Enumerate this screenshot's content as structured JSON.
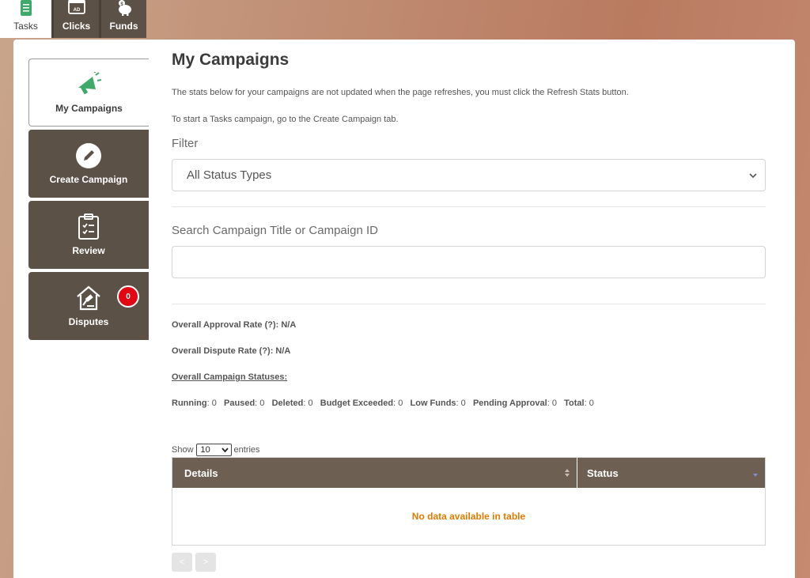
{
  "top_tabs": [
    {
      "label": "Tasks",
      "icon": "tasks-icon"
    },
    {
      "label": "Clicks",
      "icon": "ad-icon"
    },
    {
      "label": "Funds",
      "icon": "piggy-bank-icon"
    }
  ],
  "side_menu": [
    {
      "label": "My Campaigns",
      "icon": "megaphone-icon"
    },
    {
      "label": "Create Campaign",
      "icon": "pencil-icon"
    },
    {
      "label": "Review",
      "icon": "clipboard-check-icon"
    },
    {
      "label": "Disputes",
      "icon": "gavel-house-icon",
      "badge": "0"
    }
  ],
  "main": {
    "title": "My Campaigns",
    "note1": "The stats below for your campaigns are not updated when the page refreshes, you must click the Refresh Stats button.",
    "note2": "To start a Tasks campaign, go to the Create Campaign tab.",
    "filter_label": "Filter",
    "filter_value": "All Status Types",
    "search_label": "Search Campaign Title or Campaign ID",
    "search_value": ""
  },
  "stats": {
    "approval_label": "Overall Approval Rate (?): N/A",
    "dispute_label": "Overall Dispute Rate (?): N/A",
    "statuses_link": "Overall Campaign Statuses:",
    "running_label": "Running",
    "running": "0",
    "paused_label": "Paused",
    "paused": "0",
    "deleted_label": "Deleted",
    "deleted": "0",
    "budget_label": "Budget Exceeded",
    "budget": "0",
    "lowfunds_label": "Low Funds",
    "lowfunds": "0",
    "pending_label": "Pending Approval",
    "pending": "0",
    "total_label": "Total",
    "total": "0"
  },
  "table": {
    "show_label": "Show",
    "entries_value": "10",
    "entries_label": "entries",
    "col_details": "Details",
    "col_status": "Status",
    "empty": "No data available in table",
    "prev": "<",
    "next": ">"
  },
  "colors": {
    "dark_brown": "#5c5147",
    "header_brown": "#6d5f52",
    "badge_red": "#e30613",
    "empty_orange": "#e07b00",
    "megaphone_green": "#3daa6a"
  }
}
